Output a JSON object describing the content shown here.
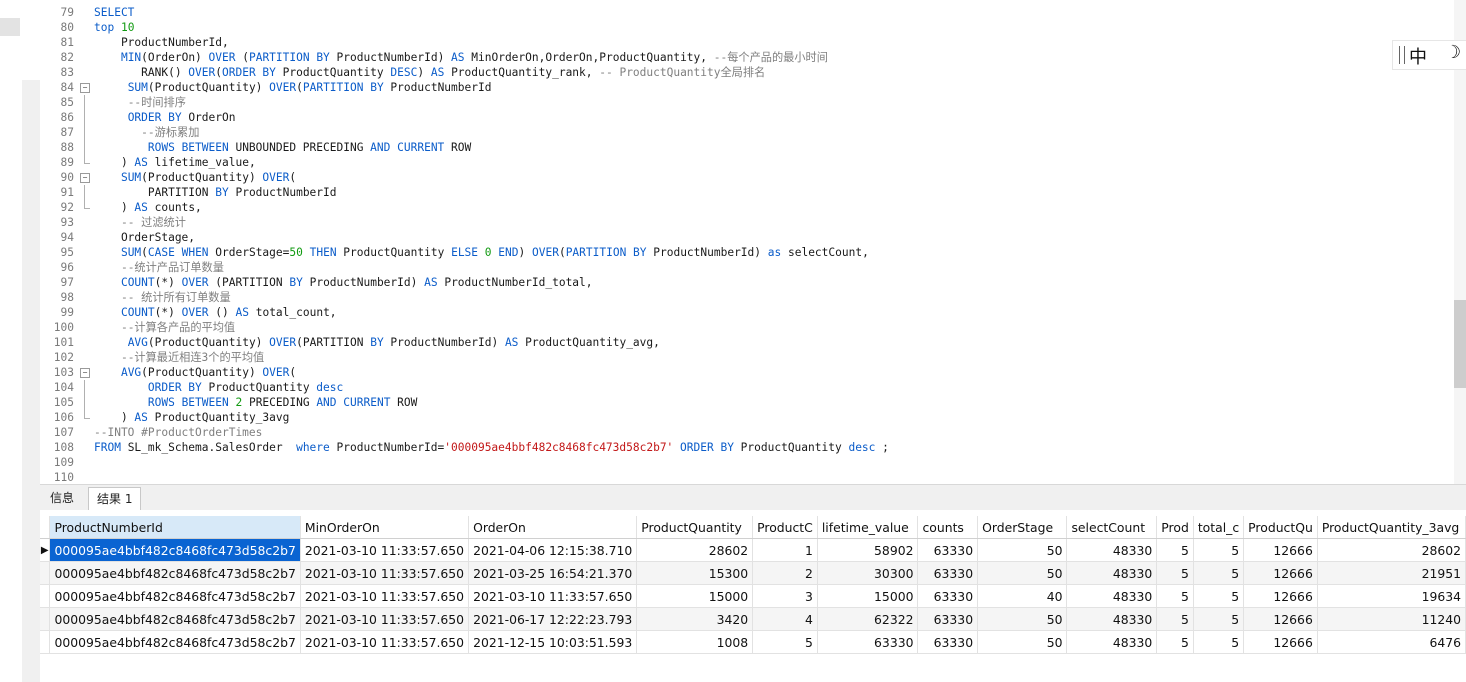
{
  "editor": {
    "lines": [
      {
        "n": "79",
        "segs": [
          [
            "kw",
            "SELECT"
          ]
        ]
      },
      {
        "n": "80",
        "segs": [
          [
            "kw",
            "top"
          ],
          [
            "t",
            " "
          ],
          [
            "num",
            "10"
          ]
        ]
      },
      {
        "n": "81",
        "segs": [
          [
            "t",
            "    ProductNumberId,"
          ]
        ]
      },
      {
        "n": "82",
        "segs": [
          [
            "t",
            "    "
          ],
          [
            "kw",
            "MIN"
          ],
          [
            "t",
            "(OrderOn) "
          ],
          [
            "kw",
            "OVER"
          ],
          [
            "t",
            " ("
          ],
          [
            "kw",
            "PARTITION BY"
          ],
          [
            "t",
            " ProductNumberId) "
          ],
          [
            "kw",
            "AS"
          ],
          [
            "t",
            " MinOrderOn,OrderOn,ProductQuantity, "
          ],
          [
            "cm",
            "--每个产品的最小时间"
          ]
        ]
      },
      {
        "n": "83",
        "segs": [
          [
            "t",
            "       RANK() "
          ],
          [
            "kw",
            "OVER"
          ],
          [
            "t",
            "("
          ],
          [
            "kw",
            "ORDER BY"
          ],
          [
            "t",
            " ProductQuantity "
          ],
          [
            "kw",
            "DESC"
          ],
          [
            "t",
            ") "
          ],
          [
            "kw",
            "AS"
          ],
          [
            "t",
            " ProductQuantity_rank, "
          ],
          [
            "cm",
            "-- ProductQuantity全局排名"
          ]
        ]
      },
      {
        "n": "84",
        "fold": "box",
        "segs": [
          [
            "t",
            "     "
          ],
          [
            "kw",
            "SUM"
          ],
          [
            "t",
            "(ProductQuantity) "
          ],
          [
            "kw",
            "OVER"
          ],
          [
            "t",
            "("
          ],
          [
            "kw",
            "PARTITION BY"
          ],
          [
            "t",
            " ProductNumberId"
          ]
        ]
      },
      {
        "n": "85",
        "fold": "line",
        "segs": [
          [
            "t",
            "     "
          ],
          [
            "cm",
            "--时间排序"
          ]
        ]
      },
      {
        "n": "86",
        "fold": "line",
        "segs": [
          [
            "t",
            "     "
          ],
          [
            "kw",
            "ORDER BY"
          ],
          [
            "t",
            " OrderOn"
          ]
        ]
      },
      {
        "n": "87",
        "fold": "line",
        "segs": [
          [
            "t",
            "       "
          ],
          [
            "cm",
            "--游标累加"
          ]
        ]
      },
      {
        "n": "88",
        "fold": "line",
        "segs": [
          [
            "t",
            "        "
          ],
          [
            "kw",
            "ROWS BETWEEN"
          ],
          [
            "t",
            " UNBOUNDED PRECEDING "
          ],
          [
            "kw",
            "AND"
          ],
          [
            "t",
            " "
          ],
          [
            "kw",
            "CURRENT"
          ],
          [
            "t",
            " ROW"
          ]
        ]
      },
      {
        "n": "89",
        "fold": "end",
        "segs": [
          [
            "t",
            "    ) "
          ],
          [
            "kw",
            "AS"
          ],
          [
            "t",
            " lifetime_value,"
          ]
        ]
      },
      {
        "n": "90",
        "fold": "box",
        "segs": [
          [
            "t",
            "    "
          ],
          [
            "kw",
            "SUM"
          ],
          [
            "t",
            "(ProductQuantity) "
          ],
          [
            "kw",
            "OVER"
          ],
          [
            "t",
            "("
          ]
        ]
      },
      {
        "n": "91",
        "fold": "line",
        "segs": [
          [
            "t",
            "        PARTITION "
          ],
          [
            "kw",
            "BY"
          ],
          [
            "t",
            " ProductNumberId"
          ]
        ]
      },
      {
        "n": "92",
        "fold": "end",
        "segs": [
          [
            "t",
            "    ) "
          ],
          [
            "kw",
            "AS"
          ],
          [
            "t",
            " counts,"
          ]
        ]
      },
      {
        "n": "93",
        "segs": [
          [
            "t",
            "    "
          ],
          [
            "cm",
            "-- 过滤统计"
          ]
        ]
      },
      {
        "n": "94",
        "segs": [
          [
            "t",
            "    OrderStage,"
          ]
        ]
      },
      {
        "n": "95",
        "segs": [
          [
            "t",
            "    "
          ],
          [
            "kw",
            "SUM"
          ],
          [
            "t",
            "("
          ],
          [
            "kw",
            "CASE WHEN"
          ],
          [
            "t",
            " OrderStage="
          ],
          [
            "num",
            "50"
          ],
          [
            "t",
            " "
          ],
          [
            "kw",
            "THEN"
          ],
          [
            "t",
            " ProductQuantity "
          ],
          [
            "kw",
            "ELSE"
          ],
          [
            "t",
            " "
          ],
          [
            "num",
            "0"
          ],
          [
            "t",
            " "
          ],
          [
            "kw",
            "END"
          ],
          [
            "t",
            ") "
          ],
          [
            "kw",
            "OVER"
          ],
          [
            "t",
            "("
          ],
          [
            "kw",
            "PARTITION BY"
          ],
          [
            "t",
            " ProductNumberId) "
          ],
          [
            "kw",
            "as"
          ],
          [
            "t",
            " selectCount,"
          ]
        ]
      },
      {
        "n": "96",
        "segs": [
          [
            "t",
            "    "
          ],
          [
            "cm",
            "--统计产品订单数量"
          ]
        ]
      },
      {
        "n": "97",
        "segs": [
          [
            "t",
            "    "
          ],
          [
            "kw",
            "COUNT"
          ],
          [
            "t",
            "(*) "
          ],
          [
            "kw",
            "OVER"
          ],
          [
            "t",
            " (PARTITION "
          ],
          [
            "kw",
            "BY"
          ],
          [
            "t",
            " ProductNumberId) "
          ],
          [
            "kw",
            "AS"
          ],
          [
            "t",
            " ProductNumberId_total,"
          ]
        ]
      },
      {
        "n": "98",
        "segs": [
          [
            "t",
            "    "
          ],
          [
            "cm",
            "-- 统计所有订单数量"
          ]
        ]
      },
      {
        "n": "99",
        "segs": [
          [
            "t",
            "    "
          ],
          [
            "kw",
            "COUNT"
          ],
          [
            "t",
            "(*) "
          ],
          [
            "kw",
            "OVER"
          ],
          [
            "t",
            " () "
          ],
          [
            "kw",
            "AS"
          ],
          [
            "t",
            " total_count,"
          ]
        ]
      },
      {
        "n": "100",
        "segs": [
          [
            "t",
            "    "
          ],
          [
            "cm",
            "--计算各产品的平均值"
          ]
        ]
      },
      {
        "n": "101",
        "segs": [
          [
            "t",
            "     "
          ],
          [
            "kw",
            "AVG"
          ],
          [
            "t",
            "(ProductQuantity) "
          ],
          [
            "kw",
            "OVER"
          ],
          [
            "t",
            "(PARTITION "
          ],
          [
            "kw",
            "BY"
          ],
          [
            "t",
            " ProductNumberId) "
          ],
          [
            "kw",
            "AS"
          ],
          [
            "t",
            " ProductQuantity_avg,"
          ]
        ]
      },
      {
        "n": "102",
        "segs": [
          [
            "t",
            "    "
          ],
          [
            "cm",
            "--计算最近相连3个的平均值"
          ]
        ]
      },
      {
        "n": "103",
        "fold": "box",
        "segs": [
          [
            "t",
            "    "
          ],
          [
            "kw",
            "AVG"
          ],
          [
            "t",
            "(ProductQuantity) "
          ],
          [
            "kw",
            "OVER"
          ],
          [
            "t",
            "("
          ]
        ]
      },
      {
        "n": "104",
        "fold": "line",
        "segs": [
          [
            "t",
            "        "
          ],
          [
            "kw",
            "ORDER BY"
          ],
          [
            "t",
            " ProductQuantity "
          ],
          [
            "kw",
            "desc"
          ]
        ]
      },
      {
        "n": "105",
        "fold": "line",
        "segs": [
          [
            "t",
            "        "
          ],
          [
            "kw",
            "ROWS BETWEEN"
          ],
          [
            "t",
            " "
          ],
          [
            "num",
            "2"
          ],
          [
            "t",
            " PRECEDING "
          ],
          [
            "kw",
            "AND"
          ],
          [
            "t",
            " "
          ],
          [
            "kw",
            "CURRENT"
          ],
          [
            "t",
            " ROW"
          ]
        ]
      },
      {
        "n": "106",
        "fold": "end",
        "segs": [
          [
            "t",
            "    ) "
          ],
          [
            "kw",
            "AS"
          ],
          [
            "t",
            " ProductQuantity_3avg"
          ]
        ]
      },
      {
        "n": "107",
        "segs": [
          [
            "cm",
            "--INTO #ProductOrderTimes"
          ]
        ]
      },
      {
        "n": "108",
        "segs": [
          [
            "kw",
            "FROM"
          ],
          [
            "t",
            " SL_mk_Schema.SalesOrder  "
          ],
          [
            "kw",
            "where"
          ],
          [
            "t",
            " ProductNumberId="
          ],
          [
            "str",
            "'000095ae4bbf482c8468fc473d58c2b7'"
          ],
          [
            "t",
            " "
          ],
          [
            "kw",
            "ORDER BY"
          ],
          [
            "t",
            " ProductQuantity "
          ],
          [
            "kw",
            "desc"
          ],
          [
            "t",
            " ;"
          ]
        ]
      },
      {
        "n": "109",
        "segs": []
      },
      {
        "n": "110",
        "segs": []
      }
    ]
  },
  "ime": {
    "mode": "中",
    "grip": "‖",
    "moon": "☽"
  },
  "tabs": {
    "info": "信息",
    "result": "结果 1"
  },
  "result": {
    "columns": [
      "ProductNumberId",
      "MinOrderOn",
      "OrderOn",
      "ProductQuantity",
      "ProductC",
      "lifetime_value",
      "counts",
      "OrderStage",
      "selectCount",
      "Prod",
      "total_c",
      "ProductQu",
      "ProductQuantity_3avg"
    ],
    "rows": [
      [
        "000095ae4bbf482c8468fc473d58c2b7",
        "2021-03-10 11:33:57.650",
        "2021-04-06 12:15:38.710",
        "28602",
        "1",
        "58902",
        "63330",
        "50",
        "48330",
        "5",
        "5",
        "12666",
        "28602"
      ],
      [
        "000095ae4bbf482c8468fc473d58c2b7",
        "2021-03-10 11:33:57.650",
        "2021-03-25 16:54:21.370",
        "15300",
        "2",
        "30300",
        "63330",
        "50",
        "48330",
        "5",
        "5",
        "12666",
        "21951"
      ],
      [
        "000095ae4bbf482c8468fc473d58c2b7",
        "2021-03-10 11:33:57.650",
        "2021-03-10 11:33:57.650",
        "15000",
        "3",
        "15000",
        "63330",
        "40",
        "48330",
        "5",
        "5",
        "12666",
        "19634"
      ],
      [
        "000095ae4bbf482c8468fc473d58c2b7",
        "2021-03-10 11:33:57.650",
        "2021-06-17 12:22:23.793",
        "3420",
        "4",
        "62322",
        "63330",
        "50",
        "48330",
        "5",
        "5",
        "12666",
        "11240"
      ],
      [
        "000095ae4bbf482c8468fc473d58c2b7",
        "2021-03-10 11:33:57.650",
        "2021-12-15 10:03:51.593",
        "1008",
        "5",
        "63330",
        "63330",
        "50",
        "48330",
        "5",
        "5",
        "12666",
        "6476"
      ]
    ],
    "current_row_marker": "▶"
  }
}
